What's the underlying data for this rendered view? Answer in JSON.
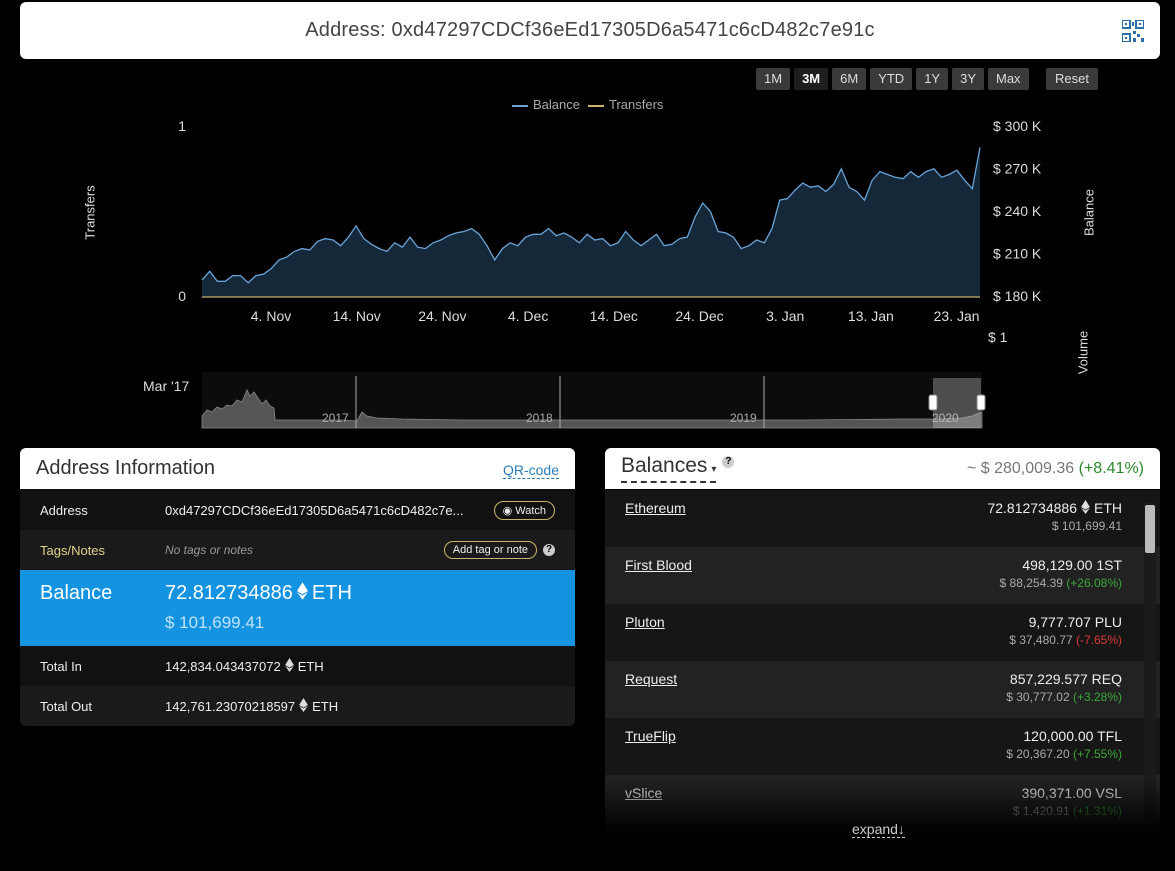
{
  "address_bar": {
    "label": "Address: 0xd47297CDCf36eEd17305D6a5471c6cD482c7e91c"
  },
  "range_buttons": [
    "1M",
    "3M",
    "6M",
    "YTD",
    "1Y",
    "3Y",
    "Max"
  ],
  "active_range": "3M",
  "reset_label": "Reset",
  "legend": [
    {
      "name": "Balance",
      "color": "#6aa3d6"
    },
    {
      "name": "Transfers",
      "color": "#c9b46a"
    }
  ],
  "chart_data": {
    "type": "area",
    "x_tick_labels": [
      "4. Nov",
      "14. Nov",
      "24. Nov",
      "4. Dec",
      "14. Dec",
      "24. Dec",
      "3. Jan",
      "13. Jan",
      "23. Jan"
    ],
    "series": [
      {
        "name": "Balance",
        "color": "#6aa3d6",
        "axis": "right",
        "values": [
          192000,
          198000,
          191000,
          191000,
          195000,
          195000,
          190000,
          195000,
          196000,
          200000,
          206000,
          208000,
          212000,
          214000,
          213000,
          219000,
          221000,
          220000,
          216000,
          222000,
          230000,
          221000,
          217000,
          214000,
          212000,
          218000,
          215000,
          222000,
          215000,
          214000,
          218000,
          220000,
          223000,
          225000,
          226000,
          228000,
          224000,
          216000,
          206000,
          214000,
          218000,
          216000,
          222000,
          224000,
          224000,
          228000,
          223000,
          225000,
          222000,
          218000,
          224000,
          220000,
          221000,
          216000,
          218000,
          226000,
          220000,
          216000,
          220000,
          224000,
          216000,
          217000,
          221000,
          222000,
          236000,
          246000,
          240000,
          226000,
          225000,
          222000,
          214000,
          216000,
          220000,
          218000,
          228000,
          248000,
          249000,
          255000,
          260000,
          257000,
          258000,
          254000,
          259000,
          270000,
          257000,
          254000,
          248000,
          262000,
          268000,
          266000,
          264000,
          263000,
          268000,
          264000,
          268000,
          270000,
          264000,
          266000,
          269000,
          262000,
          256000,
          285000
        ]
      },
      {
        "name": "Transfers",
        "color": "#c9b46a",
        "axis": "left",
        "values": [
          0
        ]
      }
    ],
    "y_left": {
      "label": "Transfers",
      "ticks": [
        "1",
        "0"
      ],
      "range": [
        0,
        1
      ]
    },
    "y_right": {
      "label": "Balance",
      "ticks": [
        "$ 300 K",
        "$ 270 K",
        "$ 240 K",
        "$ 210 K",
        "$ 180 K"
      ],
      "range": [
        180000,
        300000
      ]
    },
    "volume": {
      "label": "Volume",
      "tick": "$ 1"
    },
    "navigator": {
      "start_label": "Mar '17",
      "years": [
        "2017",
        "2018",
        "2019",
        "2020"
      ]
    }
  },
  "address_info": {
    "title": "Address Information",
    "qr_link": "QR-code",
    "rows": {
      "address_label": "Address",
      "address_value": "0xd47297CDCf36eEd17305D6a5471c6cD482c7e...",
      "watch_label": "Watch",
      "tags_label": "Tags/Notes",
      "tags_value": "No tags or notes",
      "add_tag_label": "Add tag or note",
      "help": "?",
      "balance_label": "Balance",
      "balance_eth": "72.812734886",
      "balance_unit": "ETH",
      "balance_usd": "$ 101,699.41",
      "total_in_label": "Total In",
      "total_in_value": "142,834.043437072",
      "total_in_unit": "ETH",
      "total_out_label": "Total Out",
      "total_out_value": "142,761.23070218597",
      "total_out_unit": "ETH"
    }
  },
  "balances": {
    "title": "Balances",
    "help": "?",
    "total": "~ $ 280,009.36",
    "total_change": "(+8.41%)",
    "tokens": [
      {
        "name": "Ethereum",
        "amount": "72.812734886",
        "unit": "ETH",
        "usd": "$ 101,699.41",
        "change": "",
        "dir": ""
      },
      {
        "name": "First Blood",
        "amount": "498,129.00 1ST",
        "unit": "",
        "usd": "$ 88,254.39",
        "change": "(+26.08%)",
        "dir": "pos"
      },
      {
        "name": "Pluton",
        "amount": "9,777.707 PLU",
        "unit": "",
        "usd": "$ 37,480.77",
        "change": "(-7.65%)",
        "dir": "neg"
      },
      {
        "name": "Request",
        "amount": "857,229.577 REQ",
        "unit": "",
        "usd": "$ 30,777.02",
        "change": "(+3.28%)",
        "dir": "pos"
      },
      {
        "name": "TrueFlip",
        "amount": "120,000.00 TFL",
        "unit": "",
        "usd": "$ 20,367.20",
        "change": "(+7.55%)",
        "dir": "pos"
      },
      {
        "name": "vSlice",
        "amount": "390,371.00 VSL",
        "unit": "",
        "usd": "$ 1,420.91",
        "change": "(+1.31%)",
        "dir": "pos"
      }
    ],
    "expand_label": "expand↓"
  }
}
